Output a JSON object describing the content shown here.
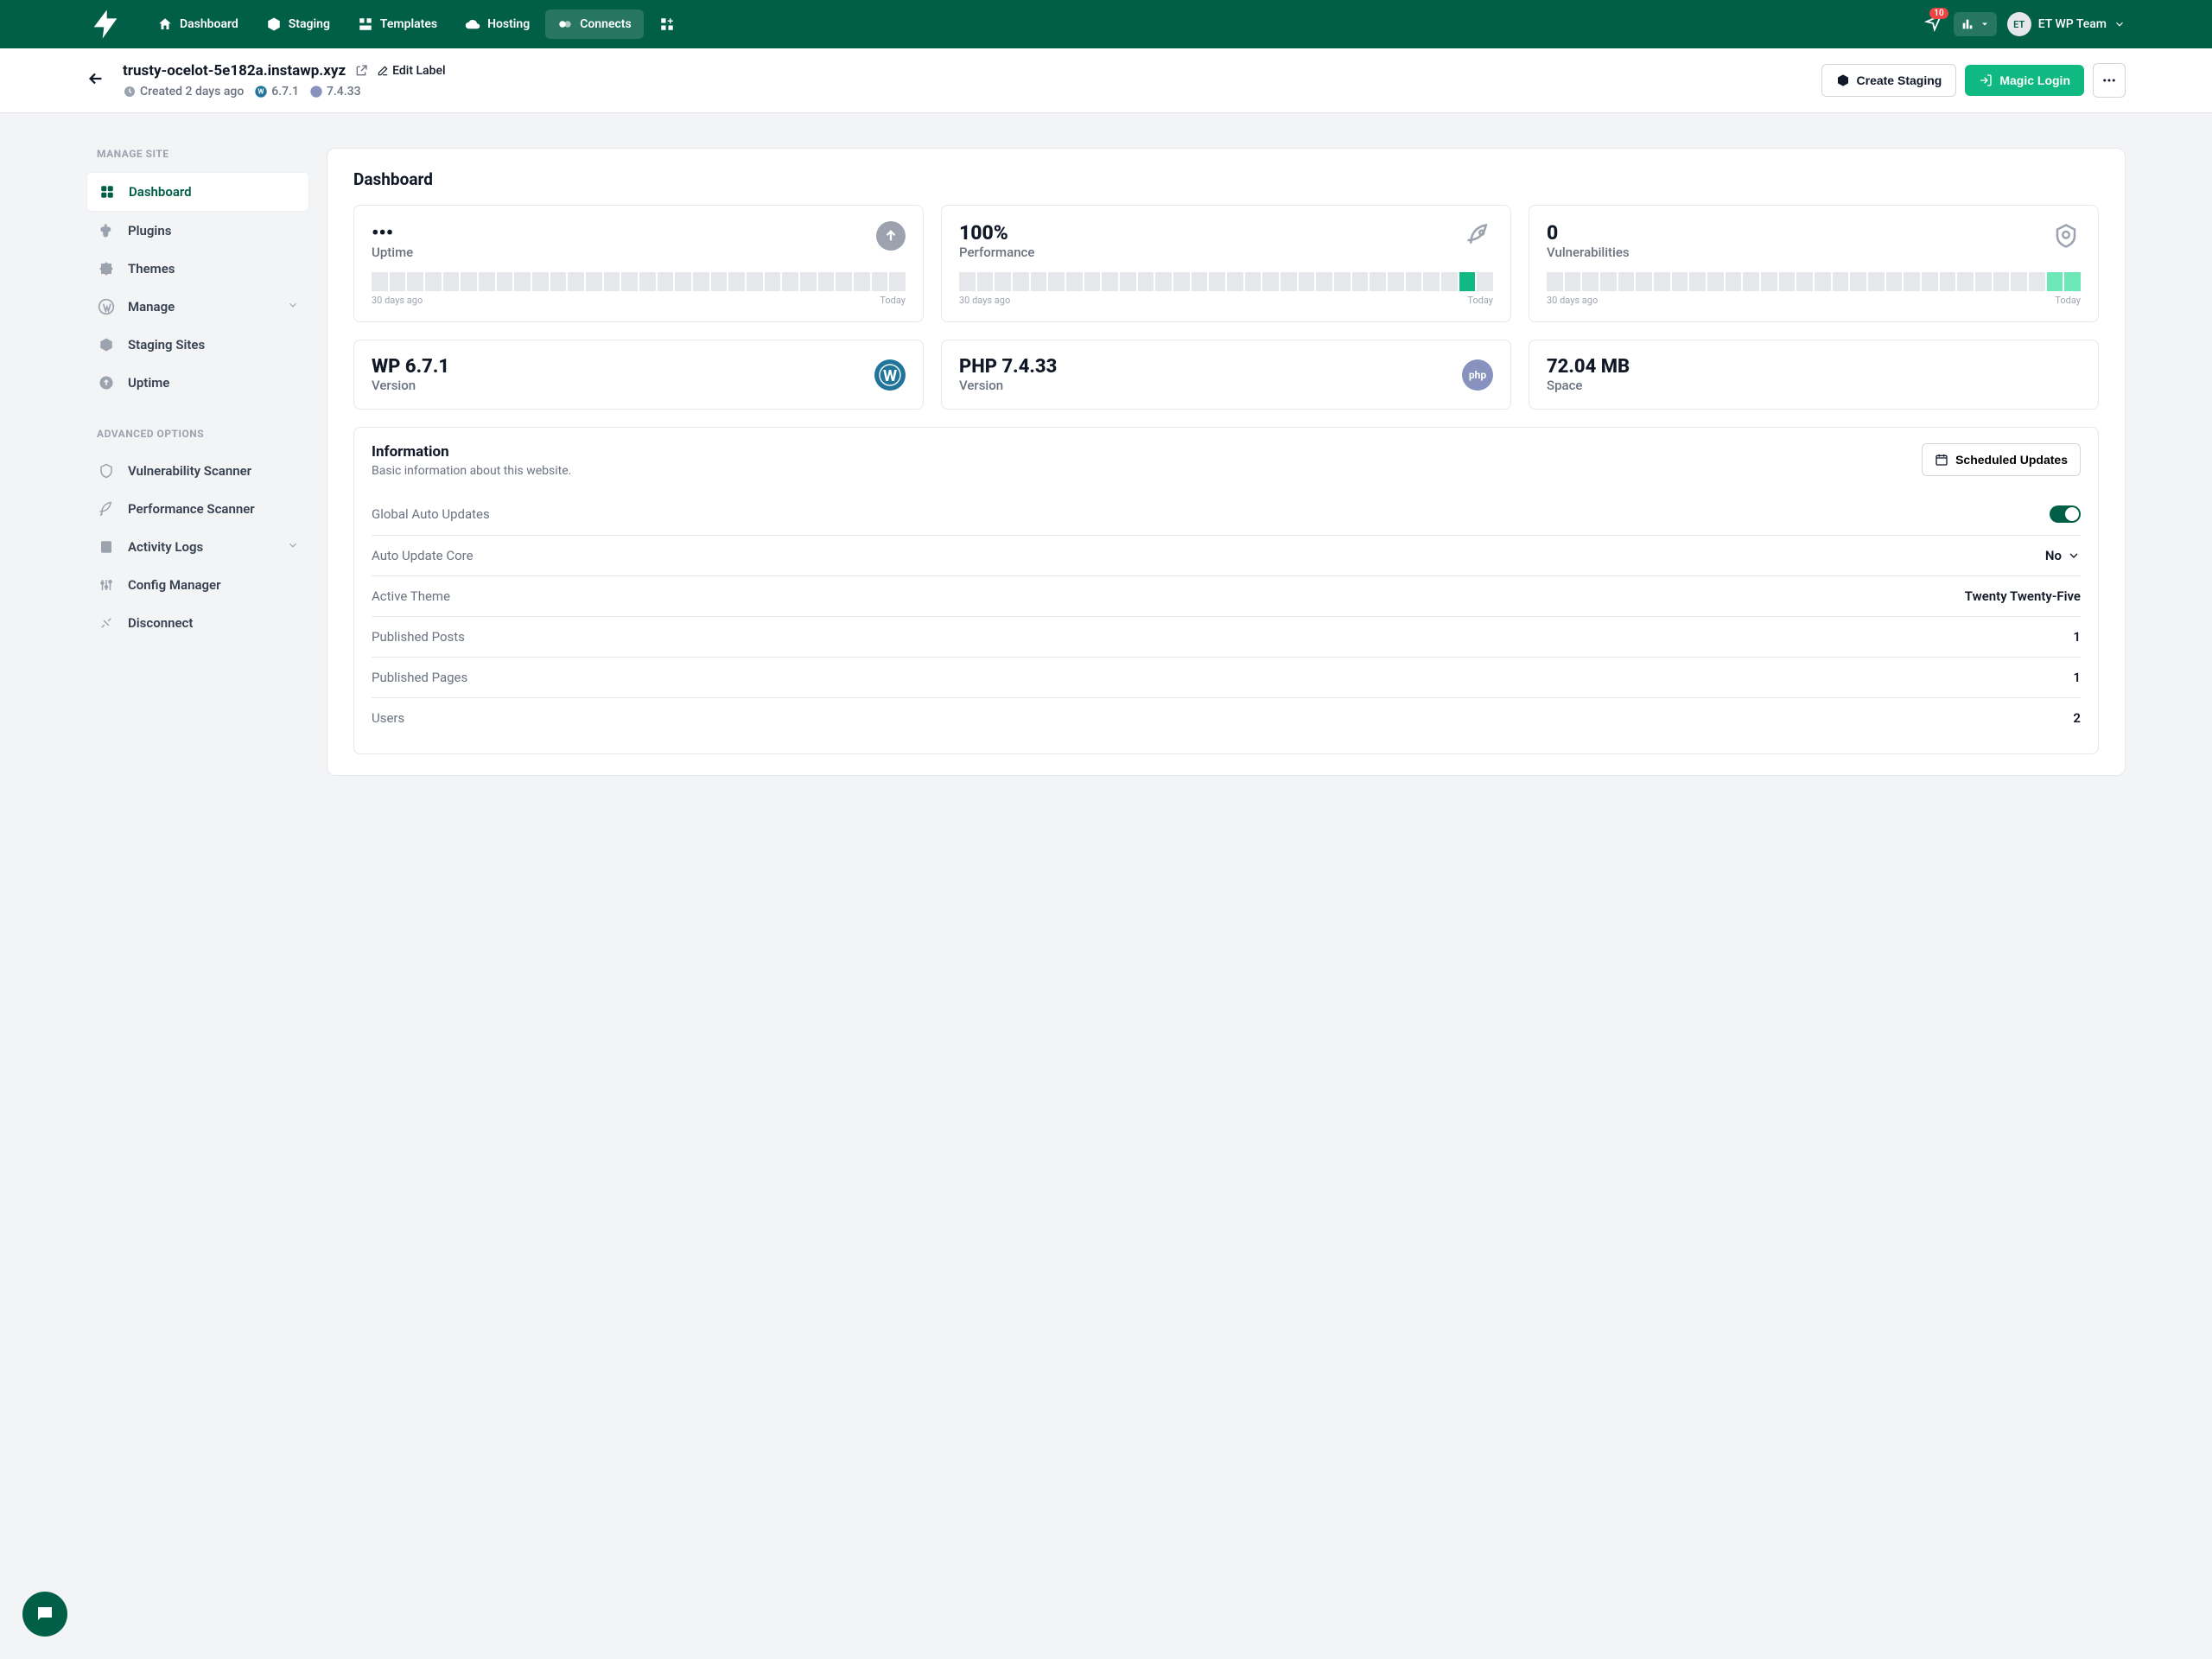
{
  "header": {
    "nav": [
      {
        "label": "Dashboard"
      },
      {
        "label": "Staging"
      },
      {
        "label": "Templates"
      },
      {
        "label": "Hosting"
      },
      {
        "label": "Connects"
      }
    ],
    "notif_badge": "10",
    "avatar_initials": "ET",
    "team_name": "ET WP Team"
  },
  "subheader": {
    "site_url": "trusty-ocelot-5e182a.instawp.xyz",
    "edit_label": "Edit Label",
    "created": "Created 2 days ago",
    "wp_version": "6.7.1",
    "php_version": "7.4.33",
    "create_staging": "Create Staging",
    "magic_login": "Magic Login"
  },
  "sidebar": {
    "section1_title": "MANAGE SITE",
    "items1": [
      {
        "label": "Dashboard"
      },
      {
        "label": "Plugins"
      },
      {
        "label": "Themes"
      },
      {
        "label": "Manage"
      },
      {
        "label": "Staging Sites"
      },
      {
        "label": "Uptime"
      }
    ],
    "section2_title": "ADVANCED OPTIONS",
    "items2": [
      {
        "label": "Vulnerability Scanner"
      },
      {
        "label": "Performance Scanner"
      },
      {
        "label": "Activity Logs"
      },
      {
        "label": "Config Manager"
      },
      {
        "label": "Disconnect"
      }
    ]
  },
  "dashboard": {
    "title": "Dashboard",
    "metric_cards": [
      {
        "value": "•••",
        "label": "Uptime",
        "range_start": "30 days ago",
        "range_end": "Today"
      },
      {
        "value": "100%",
        "label": "Performance",
        "range_start": "30 days ago",
        "range_end": "Today"
      },
      {
        "value": "0",
        "label": "Vulnerabilities",
        "range_start": "30 days ago",
        "range_end": "Today"
      }
    ],
    "stat_cards": [
      {
        "value": "WP 6.7.1",
        "label": "Version"
      },
      {
        "value": "PHP 7.4.33",
        "label": "Version"
      },
      {
        "value": "72.04 MB",
        "label": "Space"
      }
    ],
    "info": {
      "title": "Information",
      "subtitle": "Basic information about this website.",
      "scheduled_btn": "Scheduled Updates",
      "rows": [
        {
          "key": "Global Auto Updates",
          "val": ""
        },
        {
          "key": "Auto Update Core",
          "val": "No"
        },
        {
          "key": "Active Theme",
          "val": "Twenty Twenty-Five"
        },
        {
          "key": "Published Posts",
          "val": "1"
        },
        {
          "key": "Published Pages",
          "val": "1"
        },
        {
          "key": "Users",
          "val": "2"
        }
      ]
    }
  }
}
